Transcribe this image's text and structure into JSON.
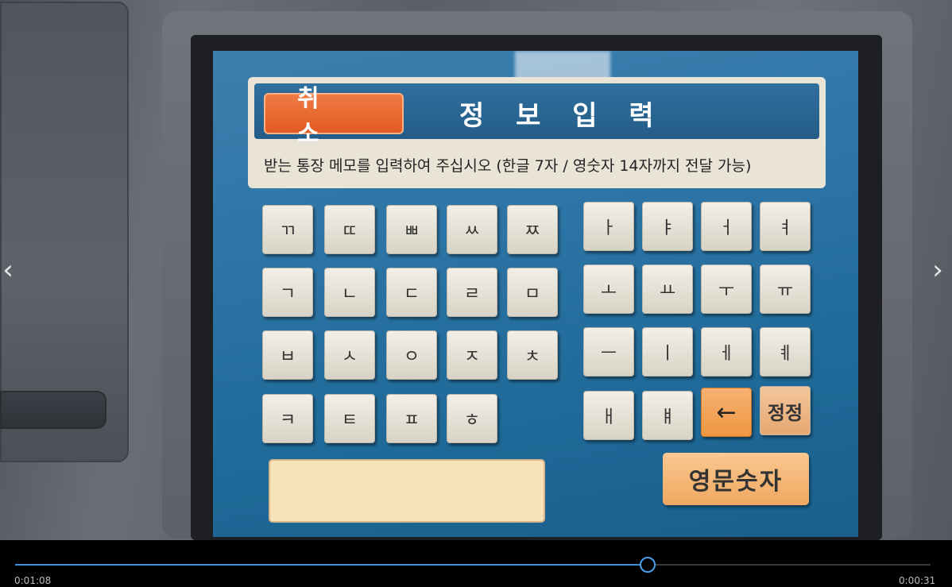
{
  "header": {
    "cancel_label": "취 소",
    "title": "정 보 입 력",
    "instruction": "받는 통장 메모를 입력하여 주십시오 (한글 7자 / 영숫자 14자까지 전달 가능)"
  },
  "keyboard": {
    "consonants_row1": [
      "ㄲ",
      "ㄸ",
      "ㅃ",
      "ㅆ",
      "ㅉ"
    ],
    "consonants_row2": [
      "ㄱ",
      "ㄴ",
      "ㄷ",
      "ㄹ",
      "ㅁ"
    ],
    "consonants_row3": [
      "ㅂ",
      "ㅅ",
      "ㅇ",
      "ㅈ",
      "ㅊ"
    ],
    "consonants_row4": [
      "ㅋ",
      "ㅌ",
      "ㅍ",
      "ㅎ"
    ],
    "vowels_row1": [
      "ㅏ",
      "ㅑ",
      "ㅓ",
      "ㅕ"
    ],
    "vowels_row2": [
      "ㅗ",
      "ㅛ",
      "ㅜ",
      "ㅠ"
    ],
    "vowels_row3": [
      "ㅡ",
      "ㅣ",
      "ㅔ",
      "ㅖ"
    ],
    "vowels_row4": [
      "ㅐ",
      "ㅒ"
    ],
    "backspace_label": "←",
    "correct_label": "정정",
    "lang_label": "영문숫자"
  },
  "memo": {
    "value": ""
  },
  "player": {
    "current_time": "0:01:08",
    "total_time": "0:00:31",
    "progress_fraction": 0.69
  },
  "nav": {
    "prev": "‹",
    "next": "›"
  },
  "colors": {
    "screen_blue": "#2d75a6",
    "cancel_orange": "#e86a32",
    "key_face": "#e8e4da",
    "progress_blue": "#3d8fd6"
  }
}
